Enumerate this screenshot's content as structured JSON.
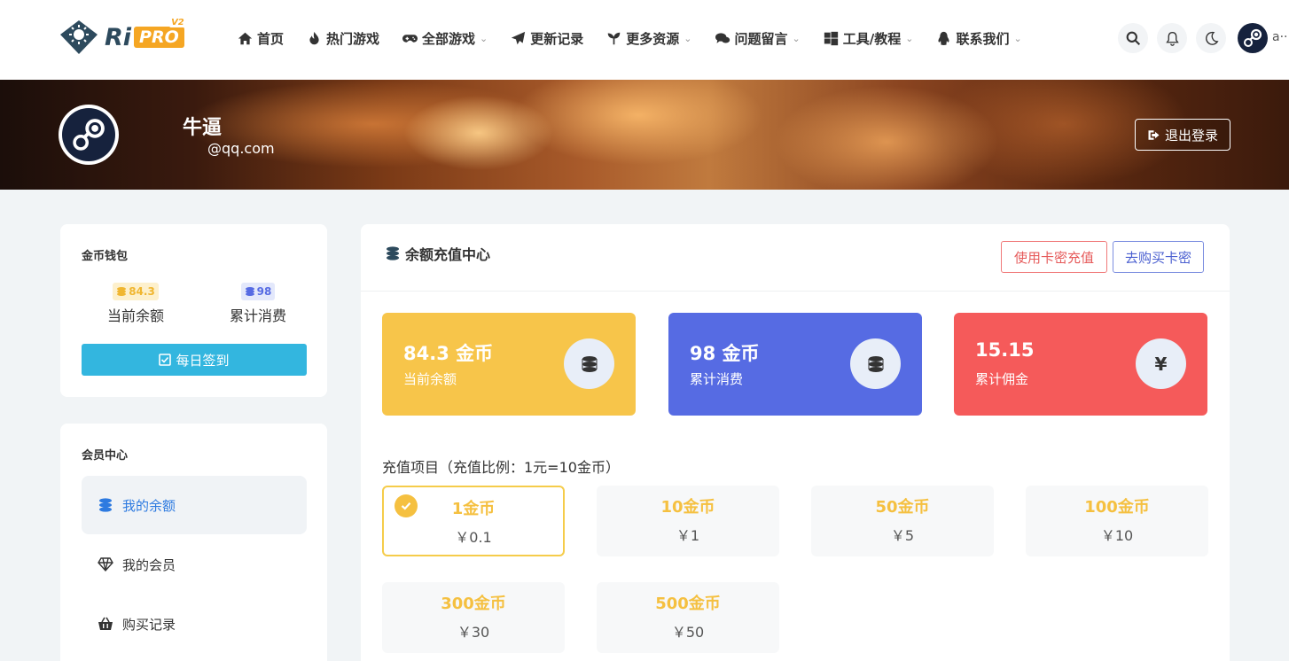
{
  "header": {
    "logo": {
      "text": "Ri",
      "badge": "PRO",
      "version": "V2"
    },
    "nav": [
      {
        "label": "首页",
        "icon": "home-icon",
        "dropdown": false
      },
      {
        "label": "热门游戏",
        "icon": "fire-icon",
        "dropdown": false
      },
      {
        "label": "全部游戏",
        "icon": "gamepad-icon",
        "dropdown": true
      },
      {
        "label": "更新记录",
        "icon": "paper-plane-icon",
        "dropdown": false
      },
      {
        "label": "更多资源",
        "icon": "seedling-icon",
        "dropdown": true
      },
      {
        "label": "问题留言",
        "icon": "comments-icon",
        "dropdown": true
      },
      {
        "label": "工具/教程",
        "icon": "windows-icon",
        "dropdown": true
      },
      {
        "label": "联系我们",
        "icon": "qq-penguin-icon",
        "dropdown": true
      }
    ],
    "chevron": "⌄",
    "user_short": "a··"
  },
  "banner": {
    "name": "牛逼",
    "email": "@qq.com",
    "logout": "退出登录"
  },
  "wallet": {
    "title": "金币钱包",
    "balance_value": "84.3",
    "balance_label": "当前余额",
    "spent_value": "98",
    "spent_label": "累计消费",
    "checkin": "每日签到"
  },
  "member": {
    "title": "会员中心",
    "items": [
      {
        "label": "我的余额",
        "icon": "coins-icon",
        "active": true
      },
      {
        "label": "我的会员",
        "icon": "diamond-icon",
        "active": false
      },
      {
        "label": "购买记录",
        "icon": "basket-icon",
        "active": false
      }
    ]
  },
  "main": {
    "title": "余额充值中心",
    "card_key_btn": "使用卡密充值",
    "buy_key_btn": "去购买卡密",
    "stats": [
      {
        "value": "84.3 金币",
        "label": "当前余额",
        "color": "#f7c54a",
        "icon": "coins-icon"
      },
      {
        "value": "98 金币",
        "label": "累计消费",
        "color": "#566be3",
        "icon": "coins-icon"
      },
      {
        "value": "15.15",
        "label": "累计佣金",
        "color": "#f55a5a",
        "icon": "yen-icon"
      }
    ],
    "yen_symbol": "¥",
    "recharge_label": "充值项目（充值比例：1元=10金币）",
    "options": [
      {
        "coins": "1金币",
        "price": "￥0.1",
        "selected": true
      },
      {
        "coins": "10金币",
        "price": "￥1",
        "selected": false
      },
      {
        "coins": "50金币",
        "price": "￥5",
        "selected": false
      },
      {
        "coins": "100金币",
        "price": "￥10",
        "selected": false
      },
      {
        "coins": "300金币",
        "price": "￥30",
        "selected": false
      },
      {
        "coins": "500金币",
        "price": "￥50",
        "selected": false
      }
    ]
  },
  "colors": {
    "accent_blue": "#2d7ae0",
    "checkin": "#33b6df",
    "coin_gold": "#f5c040",
    "danger": "#e65a5a"
  }
}
